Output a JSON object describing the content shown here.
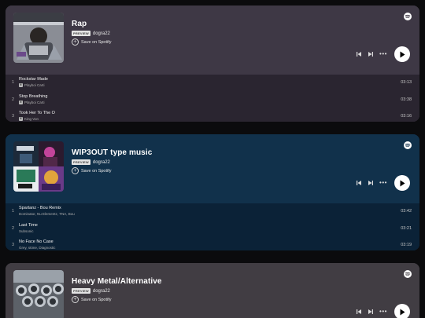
{
  "playlists": [
    {
      "title": "Rap",
      "badge": "PREVIEW",
      "owner": "dogra22",
      "save_label": "Save on Spotify",
      "colors": {
        "bg": "#3c3643",
        "tracks_bg": "#2a2530"
      },
      "tracks": [
        {
          "num": "1",
          "title": "Rockstar Made",
          "explicit": "E",
          "artist": "Playboi Carti",
          "duration": "03:13"
        },
        {
          "num": "2",
          "title": "Stop Breathing",
          "explicit": "E",
          "artist": "Playboi Carti",
          "duration": "03:38"
        },
        {
          "num": "3",
          "title": "Took Her To The O",
          "explicit": "E",
          "artist": "King Von",
          "duration": "03:16"
        }
      ]
    },
    {
      "title": "WIP3OUT type music",
      "badge": "PREVIEW",
      "owner": "dogra22",
      "save_label": "Save on Spotify",
      "colors": {
        "bg": "#10304a",
        "tracks_bg": "#0b2237"
      },
      "tracks": [
        {
          "num": "1",
          "title": "Spartanz - Bou Remix",
          "explicit": "",
          "artist": "Dominator, Nu Elementz, TNA, Bou",
          "duration": "03:42"
        },
        {
          "num": "2",
          "title": "Last Time",
          "explicit": "",
          "artist": "Subsonic",
          "duration": "03:21"
        },
        {
          "num": "3",
          "title": "No Face No Case",
          "explicit": "",
          "artist": "Grey, stöne, Diagnostic",
          "duration": "03:19"
        }
      ]
    },
    {
      "title": "Heavy Metal/Alternative",
      "badge": "PREVIEW",
      "owner": "dogra22",
      "save_label": "Save on Spotify",
      "colors": {
        "bg": "#403c42"
      },
      "tracks": []
    }
  ],
  "icons": {
    "logo": "spotify-logo-icon",
    "prev": "skip-previous-icon",
    "next": "skip-next-icon",
    "more": "more-horizontal-icon",
    "play": "play-icon",
    "save": "plus-circle-icon"
  }
}
